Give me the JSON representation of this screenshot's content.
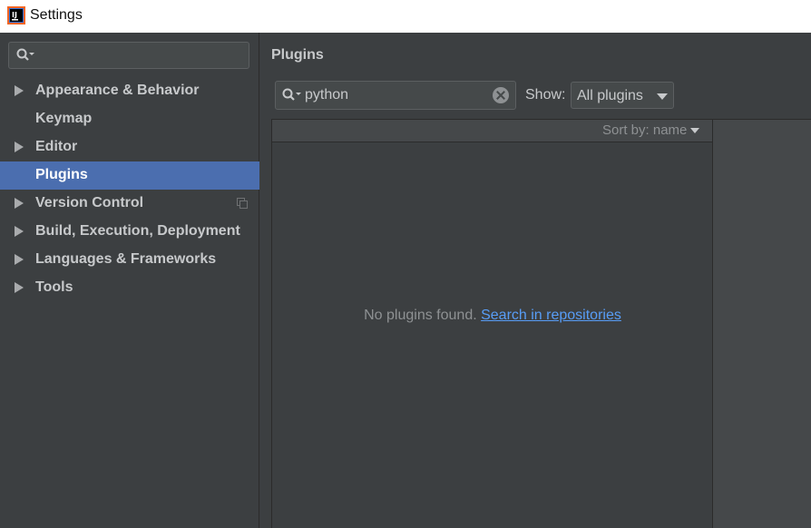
{
  "window": {
    "title": "Settings"
  },
  "sidebar": {
    "search_value": "",
    "items": [
      {
        "label": "Appearance & Behavior",
        "expandable": true,
        "selected": false
      },
      {
        "label": "Keymap",
        "expandable": false,
        "selected": false
      },
      {
        "label": "Editor",
        "expandable": true,
        "selected": false
      },
      {
        "label": "Plugins",
        "expandable": false,
        "selected": true
      },
      {
        "label": "Version Control",
        "expandable": true,
        "selected": false,
        "has_copy_icon": true
      },
      {
        "label": "Build, Execution, Deployment",
        "expandable": true,
        "selected": false
      },
      {
        "label": "Languages & Frameworks",
        "expandable": true,
        "selected": false
      },
      {
        "label": "Tools",
        "expandable": true,
        "selected": false
      }
    ]
  },
  "main": {
    "title": "Plugins",
    "search": {
      "value": "python"
    },
    "show": {
      "label": "Show:",
      "selected": "All plugins"
    },
    "sort": {
      "label": "Sort by: name"
    },
    "empty": {
      "message": "No plugins found.",
      "link": "Search in repositories"
    }
  },
  "icons": {
    "app": "intellij-app-icon",
    "search": "search-icon",
    "clear": "clear-icon",
    "expand": "triangle-right-icon",
    "copy": "copy-icon",
    "dropdown": "chevron-down-icon"
  },
  "colors": {
    "background": "#3c3f41",
    "selection": "#4b6eaf",
    "link": "#589df6",
    "text": "#c7c9cb"
  }
}
